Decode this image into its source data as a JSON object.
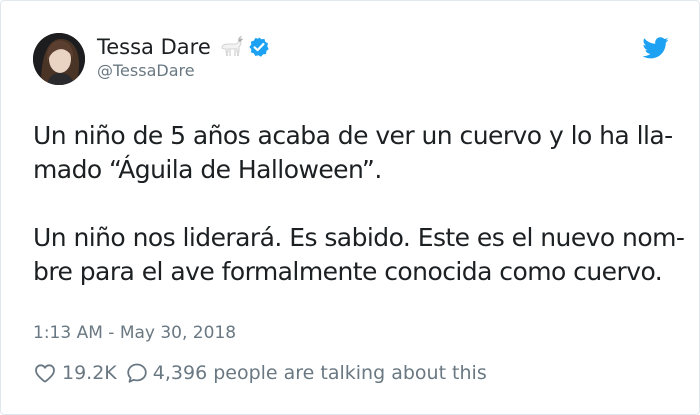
{
  "author": {
    "name": "Tessa Dare",
    "handle": "@TessaDare",
    "avatar_icon": "portrait-avatar",
    "emoji_icon": "goat-icon",
    "verified_icon": "verified-badge-icon"
  },
  "platform_icon": "twitter-bird-icon",
  "tweet": {
    "lines": [
      "Un niño de 5 años acaba de ver un cuervo y lo ha lla-",
      "mado “Águila de Halloween”.",
      "",
      "Un niño nos liderará. Es sabido. Este es el nuevo nom-",
      "bre para el ave formalmente conocida como cuervo."
    ]
  },
  "timestamp": "1:13 AM - May 30, 2018",
  "actions": {
    "likes": "19.2K",
    "replies_text": "4,396 people are talking about this"
  },
  "colors": {
    "text": "#1c2022",
    "muted": "#697882",
    "twitter_blue": "#1da1f2",
    "border": "#e1e8ed"
  }
}
